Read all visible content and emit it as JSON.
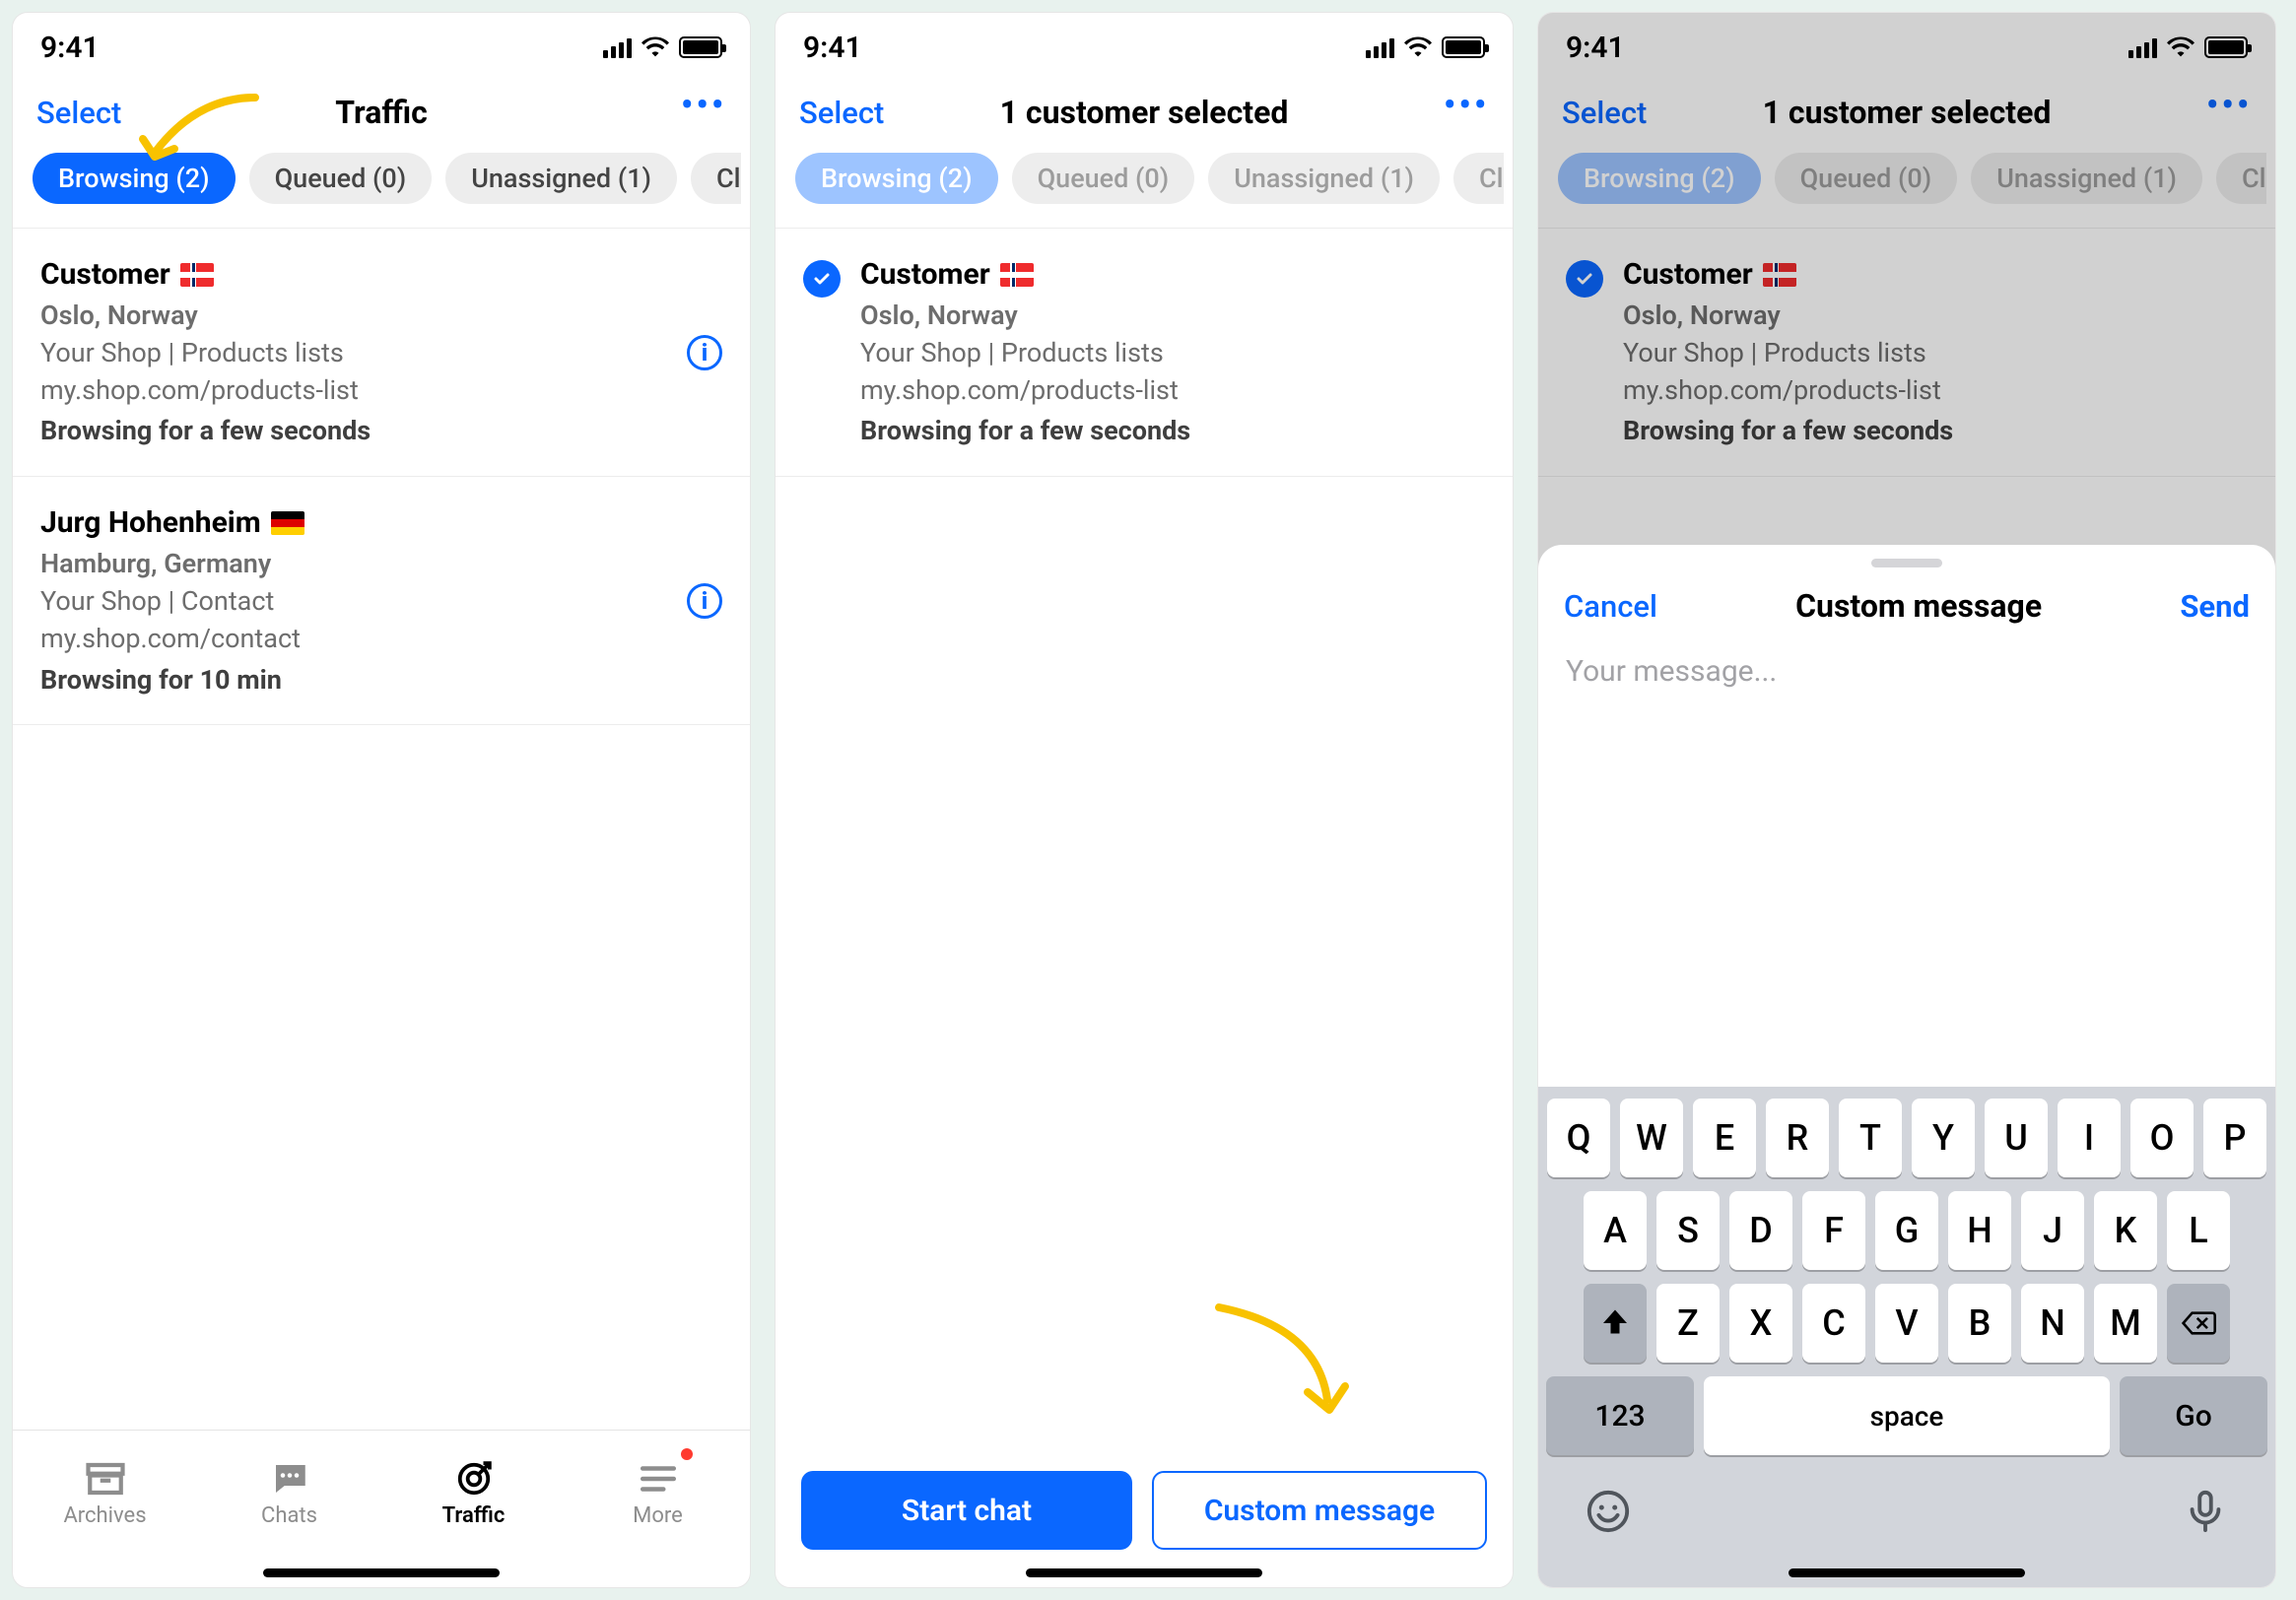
{
  "status": {
    "time": "9:41"
  },
  "nav": {
    "select": "Select",
    "title_traffic": "Traffic",
    "title_selected": "1 customer selected"
  },
  "pills": {
    "browsing": "Browsing (2)",
    "queued": "Queued (0)",
    "unassigned": "Unassigned (1)",
    "cut": "Cl"
  },
  "customers": [
    {
      "name": "Customer",
      "flag": "no",
      "location": "Oslo, Norway",
      "meta": "Your Shop | Products lists",
      "url": "my.shop.com/products-list",
      "status": "Browsing for a few seconds"
    },
    {
      "name": "Jurg Hohenheim",
      "flag": "de",
      "location": "Hamburg, Germany",
      "meta": "Your Shop | Contact",
      "url": "my.shop.com/contact",
      "status": "Browsing for 10 min"
    }
  ],
  "tabs": {
    "archives": "Archives",
    "chats": "Chats",
    "traffic": "Traffic",
    "more": "More"
  },
  "actions": {
    "start_chat": "Start chat",
    "custom_message": "Custom message"
  },
  "sheet": {
    "cancel": "Cancel",
    "title": "Custom message",
    "send": "Send",
    "placeholder": "Your message..."
  },
  "keyboard": {
    "row1": [
      "Q",
      "W",
      "E",
      "R",
      "T",
      "Y",
      "U",
      "I",
      "O",
      "P"
    ],
    "row2": [
      "A",
      "S",
      "D",
      "F",
      "G",
      "H",
      "J",
      "K",
      "L"
    ],
    "row3": [
      "Z",
      "X",
      "C",
      "V",
      "B",
      "N",
      "M"
    ],
    "num": "123",
    "space": "space",
    "go": "Go"
  }
}
